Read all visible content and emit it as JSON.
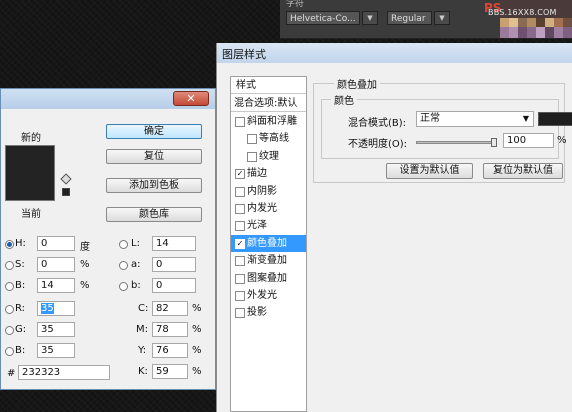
{
  "topbar": {
    "font_family": "Helvetica-Co...",
    "font_style": "Regular",
    "menu_fragment": "字符",
    "watermark": "BBS.16XX8.COM",
    "ps_logo": "PS"
  },
  "color_picker": {
    "new_label": "新的",
    "current_label": "当前",
    "ok_label": "确定",
    "reset_label": "复位",
    "add_swatch_label": "添加到色板",
    "color_library_label": "颜色库",
    "current_color": "#232323",
    "fields": {
      "H": {
        "label": "H:",
        "value": "0",
        "unit": "度"
      },
      "S": {
        "label": "S:",
        "value": "0",
        "unit": "%"
      },
      "Bv": {
        "label": "B:",
        "value": "14",
        "unit": "%"
      },
      "R": {
        "label": "R:",
        "value": "35"
      },
      "G": {
        "label": "G:",
        "value": "35"
      },
      "Bc": {
        "label": "B:",
        "value": "35"
      },
      "L": {
        "label": "L:",
        "value": "14"
      },
      "a": {
        "label": "a:",
        "value": "0"
      },
      "b": {
        "label": "b:",
        "value": "0"
      },
      "C": {
        "label": "C:",
        "value": "82",
        "unit": "%"
      },
      "M": {
        "label": "M:",
        "value": "78",
        "unit": "%"
      },
      "Y": {
        "label": "Y:",
        "value": "76",
        "unit": "%"
      },
      "K": {
        "label": "K:",
        "value": "59",
        "unit": "%"
      }
    },
    "hex_label": "#",
    "hex_value": "232323"
  },
  "layer_style": {
    "title": "图层样式",
    "styles_header": "样式",
    "blend_options": "混合选项:默认",
    "items": [
      {
        "label": "斜面和浮雕",
        "checked": false
      },
      {
        "label": "等高线",
        "checked": false
      },
      {
        "label": "纹理",
        "checked": false
      },
      {
        "label": "描边",
        "checked": true
      },
      {
        "label": "内阴影",
        "checked": false
      },
      {
        "label": "内发光",
        "checked": false
      },
      {
        "label": "光泽",
        "checked": false
      },
      {
        "label": "颜色叠加",
        "checked": true
      },
      {
        "label": "渐变叠加",
        "checked": false
      },
      {
        "label": "图案叠加",
        "checked": false
      },
      {
        "label": "外发光",
        "checked": false
      },
      {
        "label": "投影",
        "checked": false
      }
    ],
    "section_title": "颜色叠加",
    "group_title": "颜色",
    "blend_mode_label": "混合模式(B):",
    "blend_mode_value": "正常",
    "opacity_label": "不透明度(O):",
    "opacity_value": "100",
    "opacity_unit": "%",
    "opacity_level": 1.0,
    "overlay_color": "#1e1e1e",
    "set_default_label": "设置为默认值",
    "reset_default_label": "复位为默认值"
  }
}
